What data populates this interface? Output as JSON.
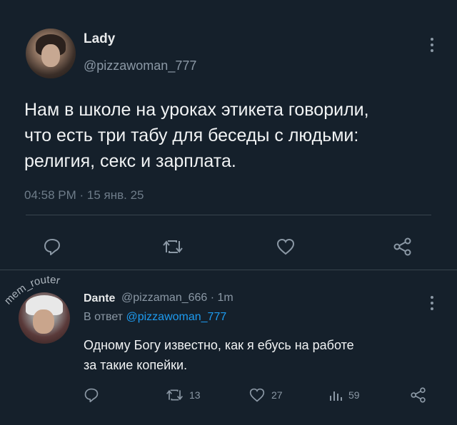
{
  "main_tweet": {
    "display_name": "Lady",
    "handle": "@pizzawoman_777",
    "text_lines": [
      "Нам в школе на уроках этикета говорили,",
      "что есть три табу для беседы с людьми:",
      "религия, секс и зарплата."
    ],
    "timestamp": "04:58 PM · 15 янв. 25",
    "actions": [
      "reply-icon",
      "retweet-icon",
      "like-icon",
      "share-icon"
    ]
  },
  "watermark": {
    "text": "mem_router"
  },
  "reply_tweet": {
    "display_name": "Dante",
    "meta": "@pizzaman_666 · 1m",
    "reply_prefix": "В ответ",
    "reply_mention": "@pizzawoman_777",
    "text_lines": [
      "Одному Богу известно, как я ебусь на работе",
      "за такие копейки."
    ],
    "counts": {
      "retweets": "13",
      "likes": "27",
      "views": "59"
    },
    "actions": [
      "reply-icon",
      "retweet-icon",
      "like-icon",
      "views-icon",
      "share-icon"
    ]
  },
  "colors": {
    "background": "#15202b",
    "text": "#e7e9ea",
    "muted": "#8b98a5",
    "link": "#1d9bf0",
    "divider": "#38444d"
  }
}
